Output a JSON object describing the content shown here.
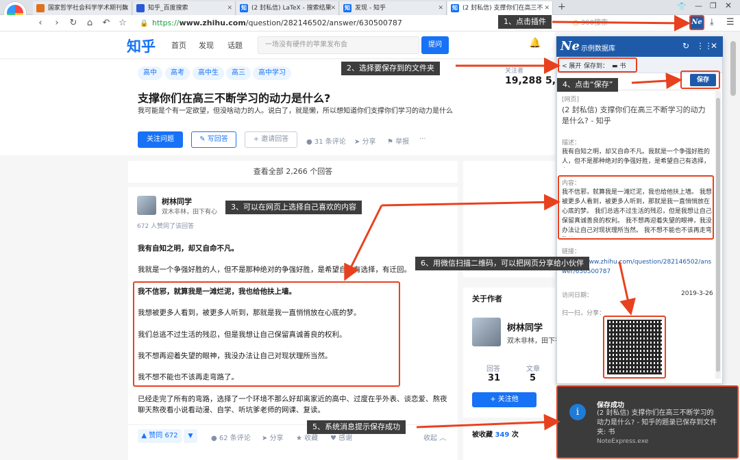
{
  "browser": {
    "tabs": [
      {
        "label": "国家哲学社会科学学术期刊数",
        "favicon": "🟧"
      },
      {
        "label": "知乎_百度搜索",
        "favicon": "🐾"
      },
      {
        "label": "(2 封私信) LaTeX - 搜索结果",
        "favicon": "知"
      },
      {
        "label": "发现 - 知乎",
        "favicon": "知"
      },
      {
        "label": "(2 封私信) 支撑你们在高三不",
        "favicon": "知"
      }
    ],
    "url_prefix": "https://",
    "url_host": "www.zhihu.com",
    "url_path": "/question/282146502/answer/630500787",
    "search_placeholder": "360搜索"
  },
  "zhihu": {
    "logo": "知乎",
    "nav": [
      "首页",
      "发现",
      "话题"
    ],
    "search_placeholder": "一场没有硬件的苹果发布会",
    "ask": "提问",
    "tags": [
      "高中",
      "高考",
      "高中生",
      "高三",
      "高中学习"
    ],
    "followers_label": "关注者",
    "followers": "19,288",
    "views_partial": "5,3",
    "question_title": "支撑你们在高三不断学习的动力是什么?",
    "question_desc": "我可能是个有一定欲望，但没啥动力的人。说白了，就是懒，所以想知道你们支撑你们学习的动力是什么",
    "follow_btn": "关注问题",
    "write_btn": "写回答",
    "invite_btn": "邀请回答",
    "comments": "31 条评论",
    "share": "分享",
    "report": "举报",
    "more": "···",
    "view_all": "查看全部 2,266 个回答",
    "author": "树林同学",
    "author_desc": "双木非林，田下有心",
    "agreed": "672 人赞同了该回答",
    "paragraphs": [
      "我有自知之明，却又自命不凡。",
      "我就是一个争强好胜的人，但不是那种绝对的争强好胜，是希望自己有选择，有迁回。",
      "我不信邪，就算我是一滩烂泥，我也给他扶上墙。",
      "我想被更多人看到，被更多人听到，那就是我一直悄悄放在心底的梦。",
      "我们总逃不过生活的残忍，但是我想让自己保留真诚善良的权利。",
      "我不想再迎着失望的眼神，我没办法让自己对现状理所当然。",
      "我不想不能也不该再走弯路了。",
      "已经走完了所有的弯路，选择了一个环境不那么好却离家近的高中、过度在乎外表、谈恋爱、熬夜聊天熬夜看小说看动漫、自学、听坑爹老师的网课、复读。"
    ],
    "vote": "▲ 赞同 672",
    "down": "▼",
    "answer_comments": "62 条评论",
    "answer_share": "分享",
    "answer_fav": "收藏",
    "answer_thanks": "感谢",
    "collapse": "收起 ︿",
    "about_author": "关于作者",
    "author2": "树林同学",
    "author2_desc": "双木非林，田下有",
    "stats": [
      {
        "label": "回答",
        "value": "31"
      },
      {
        "label": "文章",
        "value": "5"
      }
    ],
    "follow_him": "+ 关注他",
    "favorited_prefix": "被收藏 ",
    "favorited_count": "349",
    "favorited_suffix": " 次"
  },
  "plugin": {
    "logo": "Ne",
    "name": "示例数据库",
    "expand": "< 展开",
    "save_to": "保存到：",
    "folder": "▬ 书",
    "save_btn": "保存",
    "web_tag": "[网页]",
    "page_title": "(2 封私信) 支撑你们在高三不断学习的动力是什么? - 知乎",
    "desc_label": "描述：",
    "desc": "我有自知之明，却又自命不凡。我就是一个争强好胜的人，但不是那种绝对的争强好胜，是希望自己有选择，有...",
    "content_label": "内容：",
    "content": "我不信邪，就算我是一滩烂泥，我也给他扶上墙。 我想被更多人看到，被更多人听到，那就是我一直悄悄放在心底的梦。 我们总逃不过生活的残忍，但是我想让自己保留真诚善良的权利。 我不想再迎着失望的眼神，我没办法让自己对现状理所当然。 我不想不能也不该再走弯路了。",
    "link_label": "链接：",
    "link": "https://www.zhihu.com/question/282146502/answer/630500787",
    "date_label": "访问日期：",
    "date": "2019-3-26",
    "scan_label": "扫一扫，分享："
  },
  "notification": {
    "title": "保存成功",
    "body": "(2 封私信) 支撑你们在高三不断学习的动力是什么? - 知乎的题录已保存到文件夹: 书",
    "app": "NoteExpress.exe"
  },
  "annotations": {
    "a1": "1、点击插件",
    "a2": "2、选择要保存到的文件夹",
    "a3": "3、可以在网页上选择自己喜欢的内容",
    "a4": "4、点击“保存”",
    "a5": "5、系统消息提示保存成功",
    "a6": "6、用微信扫描二维码，可以把网页分享给小伙伴"
  },
  "colors": {
    "zhihu_blue": "#1772f6",
    "annotation_red": "#e8411f",
    "plugin_blue": "#1e5aa8"
  }
}
